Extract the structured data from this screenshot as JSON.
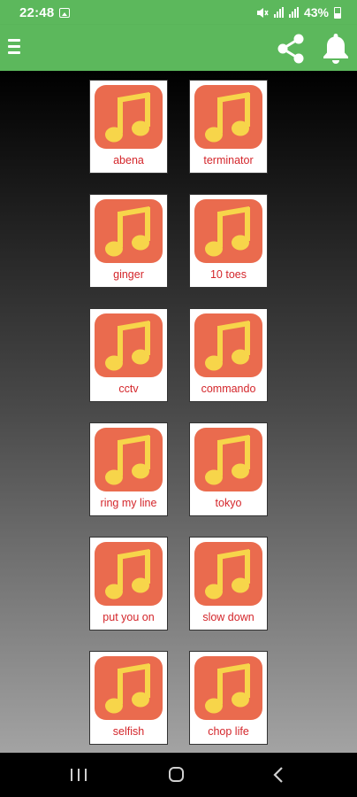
{
  "status_bar": {
    "time": "22:48",
    "battery": "43%"
  },
  "app_bar": {
    "icons": [
      "menu-icon",
      "share-icon",
      "bell-icon"
    ]
  },
  "colors": {
    "accent": "#5cb85c",
    "tile_icon_bg": "#ea6b4e",
    "note": "#f7d54a",
    "label": "#d4262b"
  },
  "tracks": [
    {
      "label": "abena"
    },
    {
      "label": "terminator"
    },
    {
      "label": "ginger"
    },
    {
      "label": "10 toes"
    },
    {
      "label": "cctv"
    },
    {
      "label": "commando"
    },
    {
      "label": "ring my line"
    },
    {
      "label": "tokyo"
    },
    {
      "label": "put you on"
    },
    {
      "label": "slow down"
    },
    {
      "label": "selfish"
    },
    {
      "label": "chop life"
    }
  ],
  "nav_bar": {
    "icons": [
      "recents-icon",
      "home-icon",
      "back-icon"
    ]
  }
}
